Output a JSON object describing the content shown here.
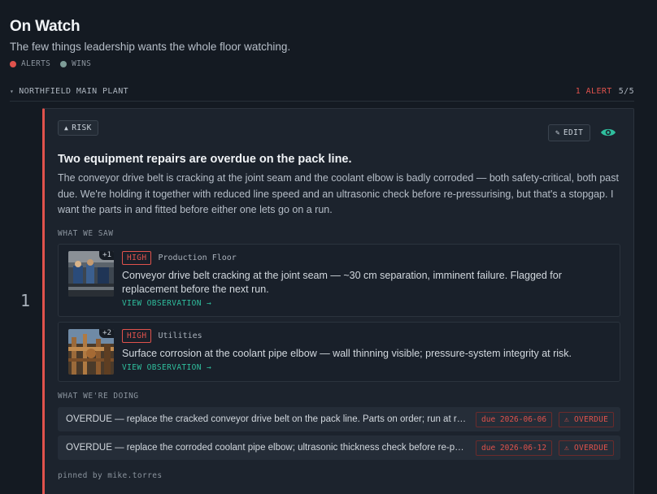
{
  "header": {
    "title": "On Watch",
    "subtitle": "The few things leadership wants the whole floor watching."
  },
  "legend": {
    "alerts_label": "ALERTS",
    "wins_label": "WINS",
    "alerts_color": "#e0524c",
    "wins_color": "#7d9c97"
  },
  "section": {
    "caret": "▾",
    "name": "NORTHFIELD MAIN PLANT",
    "alert_count": "1 ALERT",
    "progress": "5/5"
  },
  "row_number": "1",
  "card": {
    "risk_icon": "▲",
    "risk_label": "RISK",
    "edit_icon": "✎",
    "edit_label": "EDIT",
    "title": "Two equipment repairs are overdue on the pack line.",
    "body": "The conveyor drive belt is cracking at the joint seam and the coolant elbow is badly corroded — both safety-critical, both past due. We're holding it together with reduced line speed and an ultrasonic check before re-pressurising, but that's a stopgap. I want the parts in and fitted before either one lets go on a run.",
    "observations_label": "WHAT WE SAW",
    "actions_label": "WHAT WE'RE DOING",
    "pinned_by": "pinned by mike.torres",
    "observations": [
      {
        "thumb_count": "+1",
        "severity": "HIGH",
        "location": "Production Floor",
        "description": "Conveyor drive belt cracking at the joint seam — ~30 cm separation, imminent failure. Flagged for replacement before the next run.",
        "link": "VIEW OBSERVATION →"
      },
      {
        "thumb_count": "+2",
        "severity": "HIGH",
        "location": "Utilities",
        "description": "Surface corrosion at the coolant pipe elbow — wall thinning visible; pressure-system integrity at risk.",
        "link": "VIEW OBSERVATION →"
      }
    ],
    "actions": [
      {
        "text": "OVERDUE — replace the cracked conveyor drive belt on the pack line. Parts on order; run at reduced speed until fitted.",
        "due": "due 2026-06-06",
        "status": "⚠ OVERDUE"
      },
      {
        "text": "OVERDUE — replace the corroded coolant pipe elbow; ultrasonic thickness check before re-pressurising.",
        "due": "due 2026-06-12",
        "status": "⚠ OVERDUE"
      }
    ]
  },
  "colors": {
    "accent_red": "#e0524c",
    "accent_teal": "#2fbf9e",
    "background": "#141a22",
    "card": "#1c232d"
  },
  "icons": {
    "eye": "eye-icon",
    "risk": "warning-triangle-icon",
    "edit": "pencil-icon",
    "caret": "chevron-down-icon"
  }
}
